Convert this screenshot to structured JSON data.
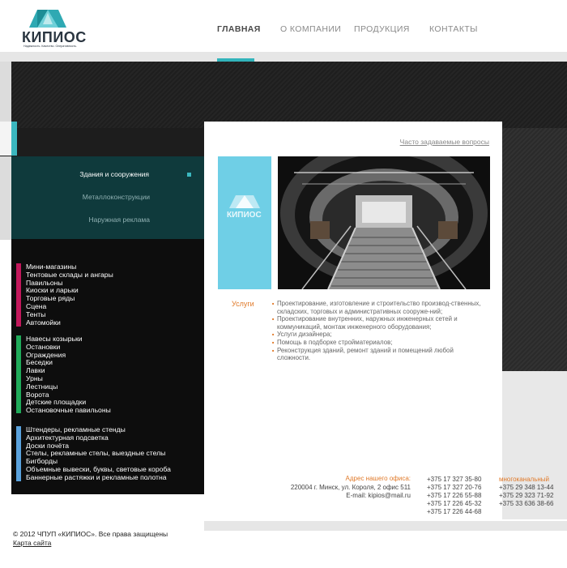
{
  "brand": {
    "name": "КИПИОС",
    "tagline": "Надежность. Качество. Оперативность.",
    "accent": "#32b4bb"
  },
  "nav": {
    "items": [
      "ГЛАВНАЯ",
      "О КОМПАНИИ",
      "ПРОДУКЦИЯ",
      "КОНТАКТЫ"
    ],
    "active": "ГЛАВНАЯ"
  },
  "submenu": {
    "items": [
      "Здания и сооружения",
      "Металлоконструкции",
      "Наружная реклама"
    ],
    "active": "Здания и сооружения"
  },
  "categories": [
    {
      "color": "#c2185b",
      "items": [
        "Мини-магазины",
        "Тентовые склады и ангары",
        "Павильоны",
        "Киоски и ларьки",
        "Торговые ряды",
        "Сцена",
        "Тенты",
        "Автомойки"
      ]
    },
    {
      "color": "#1faa59",
      "items": [
        "Навесы козырьки",
        "Остановки",
        "Ограждения",
        "Беседки",
        "Лавки",
        "Урны",
        "Лестницы",
        "Ворота",
        "Детские площадки",
        "Остановочные павильоны"
      ]
    },
    {
      "color": "#5aa2dd",
      "items": [
        "Штендеры, рекламные стенды",
        "Архитектурная подсветка",
        "Доски почёта",
        "Стелы, рекламные стелы, выездные стелы",
        "Бигборды",
        "Объемные вывески, буквы, световые короба",
        "Баннерные растяжки и рекламные полотна"
      ]
    }
  ],
  "content": {
    "faq_link": "Часто задаваемые вопросы",
    "box_logo_text": "КИПИОС",
    "services_title": "Услуги",
    "services": [
      "Проектирование, изготовление и строительство производ-ственных, складских, торговых и административных сооруже-ний;",
      "Проектирование внутренних, наружных инженерных сетей и коммуникаций, монтаж инженерного оборудования;",
      "Услуги дизайнера;",
      "Помощь в подборке стройматериалов;",
      "Реконструкция зданий, ремонт зданий и помещений любой сложности."
    ]
  },
  "contacts": {
    "address_title": "Адрес нашего офиса:",
    "address": "220004 г. Минск, ул. Короля, 2 офис 511",
    "email": "E-mail: kipios@mail.ru",
    "phones": [
      "+375 17 327 35-80",
      "+375 17 327 20-76",
      "+375 17 226 55-88",
      "+375 17 226 45-32",
      "+375 17 226 44-68"
    ],
    "mobile_title": "многоканальный",
    "mobile_phones": [
      "+375 29 348 13-44",
      "+375 29 323 71-92",
      "+375 33 636 38-66"
    ]
  },
  "footer": {
    "copyright": "© 2012 ЧПУП «КИПИОС». Все права защищены",
    "sitemap": "Карта сайта"
  }
}
